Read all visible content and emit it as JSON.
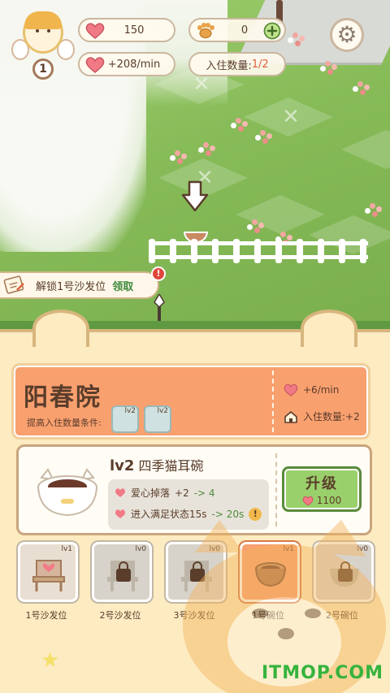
{
  "hud": {
    "level": "1",
    "hearts": "150",
    "paws": "0",
    "rate": "+208/min",
    "residents_label": "入住数量:",
    "residents_value": "1/2"
  },
  "unlock": {
    "text": "解锁1号沙发位",
    "claim": "领取",
    "badge": "!"
  },
  "yard": {
    "name": "阳春院",
    "condition_label": "提高入住数量条件:",
    "requirements": [
      {
        "level": "lv2"
      },
      {
        "level": "lv2"
      }
    ],
    "bonus_rate": "+6/min",
    "bonus_residents": "入住数量:+2"
  },
  "item": {
    "level": "lv2",
    "name": "四季猫耳碗",
    "effect1_label": "爱心掉落",
    "effect1_value": "+2",
    "effect1_next": "-> 4",
    "effect2_label": "进入满足状态15s",
    "effect2_next": "-> 20s",
    "warn": "!",
    "upgrade_label": "升级",
    "upgrade_cost": "1100"
  },
  "slots": [
    {
      "label": "1号沙发位",
      "level": "lv1",
      "icon": "chair-icon",
      "state": "owned"
    },
    {
      "label": "2号沙发位",
      "level": "lv0",
      "icon": "lock-icon",
      "state": "locked"
    },
    {
      "label": "3号沙发位",
      "level": "lv0",
      "icon": "lock-icon",
      "state": "locked"
    },
    {
      "label": "1号碗位",
      "level": "lv1",
      "icon": "bowl-icon",
      "state": "selected"
    },
    {
      "label": "2号碗位",
      "level": "lv0",
      "icon": "lock-icon",
      "state": "locked"
    }
  ],
  "watermark": "ITMOP.COM",
  "colors": {
    "panel_bg": "#fdebc2",
    "header_orange": "#f9a06f",
    "upgrade_green": "#9ad06b",
    "heart_pink": "#f27a86"
  }
}
